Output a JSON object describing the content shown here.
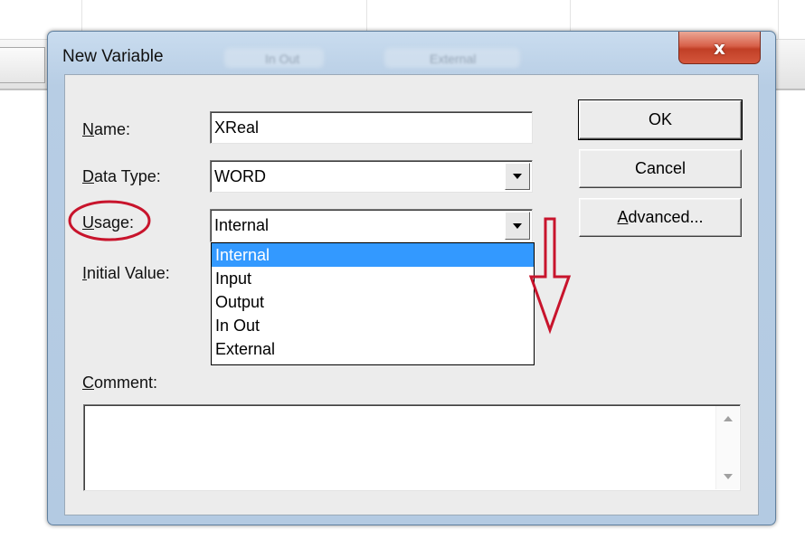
{
  "dialog": {
    "title": "New Variable",
    "close_glyph": "x",
    "background_tabs": [
      "In Out",
      "External"
    ]
  },
  "form": {
    "name_label_key": "N",
    "name_label_rest": "ame:",
    "name_value": "XReal",
    "datatype_label_key": "D",
    "datatype_label_rest": "ata Type:",
    "datatype_value": "WORD",
    "usage_label_key": "U",
    "usage_label_rest": "sage:",
    "usage_value": "Internal",
    "initial_value_label_key": "I",
    "initial_value_label_rest": "nitial Value:",
    "comment_label_key": "C",
    "comment_label_rest": "omment:",
    "comment_value": ""
  },
  "buttons": {
    "ok": "OK",
    "cancel": "Cancel",
    "advanced_key": "A",
    "advanced_rest": "dvanced..."
  },
  "usage_dropdown": {
    "options": [
      "Internal",
      "Input",
      "Output",
      "In Out",
      "External"
    ],
    "selected": "Internal"
  },
  "annotation_color": "#c8142c"
}
